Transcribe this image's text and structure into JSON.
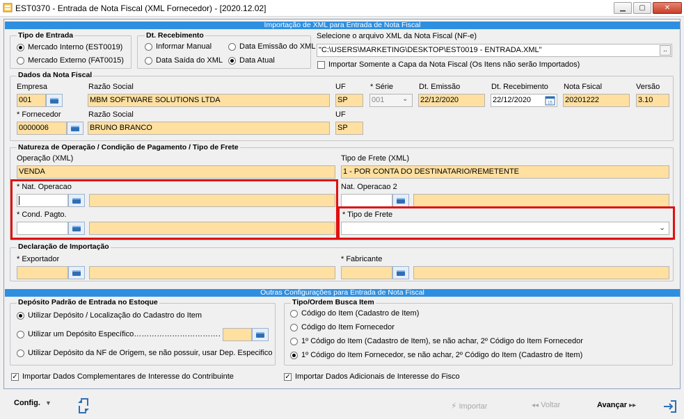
{
  "window": {
    "title": "EST0370 - Entrada de Nota Fiscal (XML Fornecedor) - [2020.12.02]"
  },
  "import_section": {
    "header": "Importação de XML para Entrada de Nota Fiscal"
  },
  "tipo_entrada": {
    "legend": "Tipo de Entrada",
    "opt1": "Mercado Interno (EST0019)",
    "opt2": "Mercado Externo (FAT0015)",
    "selected": "opt1"
  },
  "dt_recebimento": {
    "legend": "Dt. Recebimento",
    "opt1": "Informar Manual",
    "opt2": "Data Emissão do XML",
    "opt3": "Data Saída do XML",
    "opt4": "Data Atual",
    "selected": "opt4"
  },
  "xml_file": {
    "label": "Selecione o arquivo XML da Nota Fiscal (NF-e)",
    "value": "\"C:\\USERS\\MARKETING\\DESKTOP\\EST0019 - ENTRADA.XML\"",
    "browse_label": "..",
    "capa_label": "Importar Somente a Capa da Nota Fiscal (Os Itens não serão Importados)"
  },
  "dados_nf": {
    "legend": "Dados da Nota Fiscal",
    "empresa_label": "Empresa",
    "empresa_value": "001",
    "razao_label": "Razão Social",
    "razao_value": "MBM SOFTWARE SOLUTIONS LTDA",
    "uf_label": "UF",
    "uf_value": "SP",
    "serie_label": "* Série",
    "serie_value": "001",
    "dt_emissao_label": "Dt. Emissão",
    "dt_emissao_value": "22/12/2020",
    "dt_receb_label": "Dt. Recebimento",
    "dt_receb_value": "22/12/2020",
    "nota_label": "Nota Fsical",
    "nota_value": "20201222",
    "versao_label": "Versão",
    "versao_value": "3.10",
    "fornecedor_label": "* Fornecedor",
    "fornecedor_value": "0000006",
    "razao2_label": "Razão Social",
    "razao2_value": "BRUNO BRANCO",
    "uf2_label": "UF",
    "uf2_value": "SP"
  },
  "natureza": {
    "legend": "Natureza de Operação / Condição de Pagamento / Tipo de Frete",
    "operacao_label": "Operação (XML)",
    "operacao_value": "VENDA",
    "tipo_frete_xml_label": "Tipo de Frete (XML)",
    "tipo_frete_xml_value": "1 - POR CONTA DO DESTINATARIO/REMETENTE",
    "nat_op_label": "* Nat. Operacao",
    "nat_op2_label": "Nat. Operacao 2",
    "cond_pagto_label": "* Cond. Pagto.",
    "tipo_frete_label": "* Tipo de Frete"
  },
  "importacao": {
    "legend": "Declaração de Importação",
    "exportador_label": "* Exportador",
    "fabricante_label": "* Fabricante"
  },
  "outras": {
    "header": "Outras Configurações para Entrada de Nota Fiscal"
  },
  "deposito": {
    "legend": "Depósito Padrão de Entrada no Estoque",
    "opt1": "Utilizar Depósito / Localização do Cadastro do Item",
    "opt2": "Utilizar um Depósito Específico………………………………",
    "opt3": "Utilizar Depósito da NF de Origem, se não possuir, usar Dep. Especifico",
    "selected": "opt1"
  },
  "busca_item": {
    "legend": "Tipo/Ordem Busca Item",
    "opt1": "Código do Item (Cadastro de Item)",
    "opt2": "Código do Item Fornecedor",
    "opt3": "1º Código do Item (Cadastro de Item), se não achar, 2º Código do Item Fornecedor",
    "opt4": "1º Código do Item Fornecedor, se não achar, 2º Código do Item (Cadastro de Item)",
    "selected": "opt4"
  },
  "checks": {
    "complementares": "Importar Dados Complementares de Interesse do Contribuinte",
    "adicionais": "Importar Dados Adicionais de Interesse do Fisco"
  },
  "toolbar": {
    "config": "Config.",
    "importar": "Importar",
    "voltar": "Voltar",
    "avancar": "Avançar"
  },
  "colors": {
    "accent": "#2e8fe0",
    "required_field": "#ffe0a0",
    "highlight": "#e01010"
  }
}
